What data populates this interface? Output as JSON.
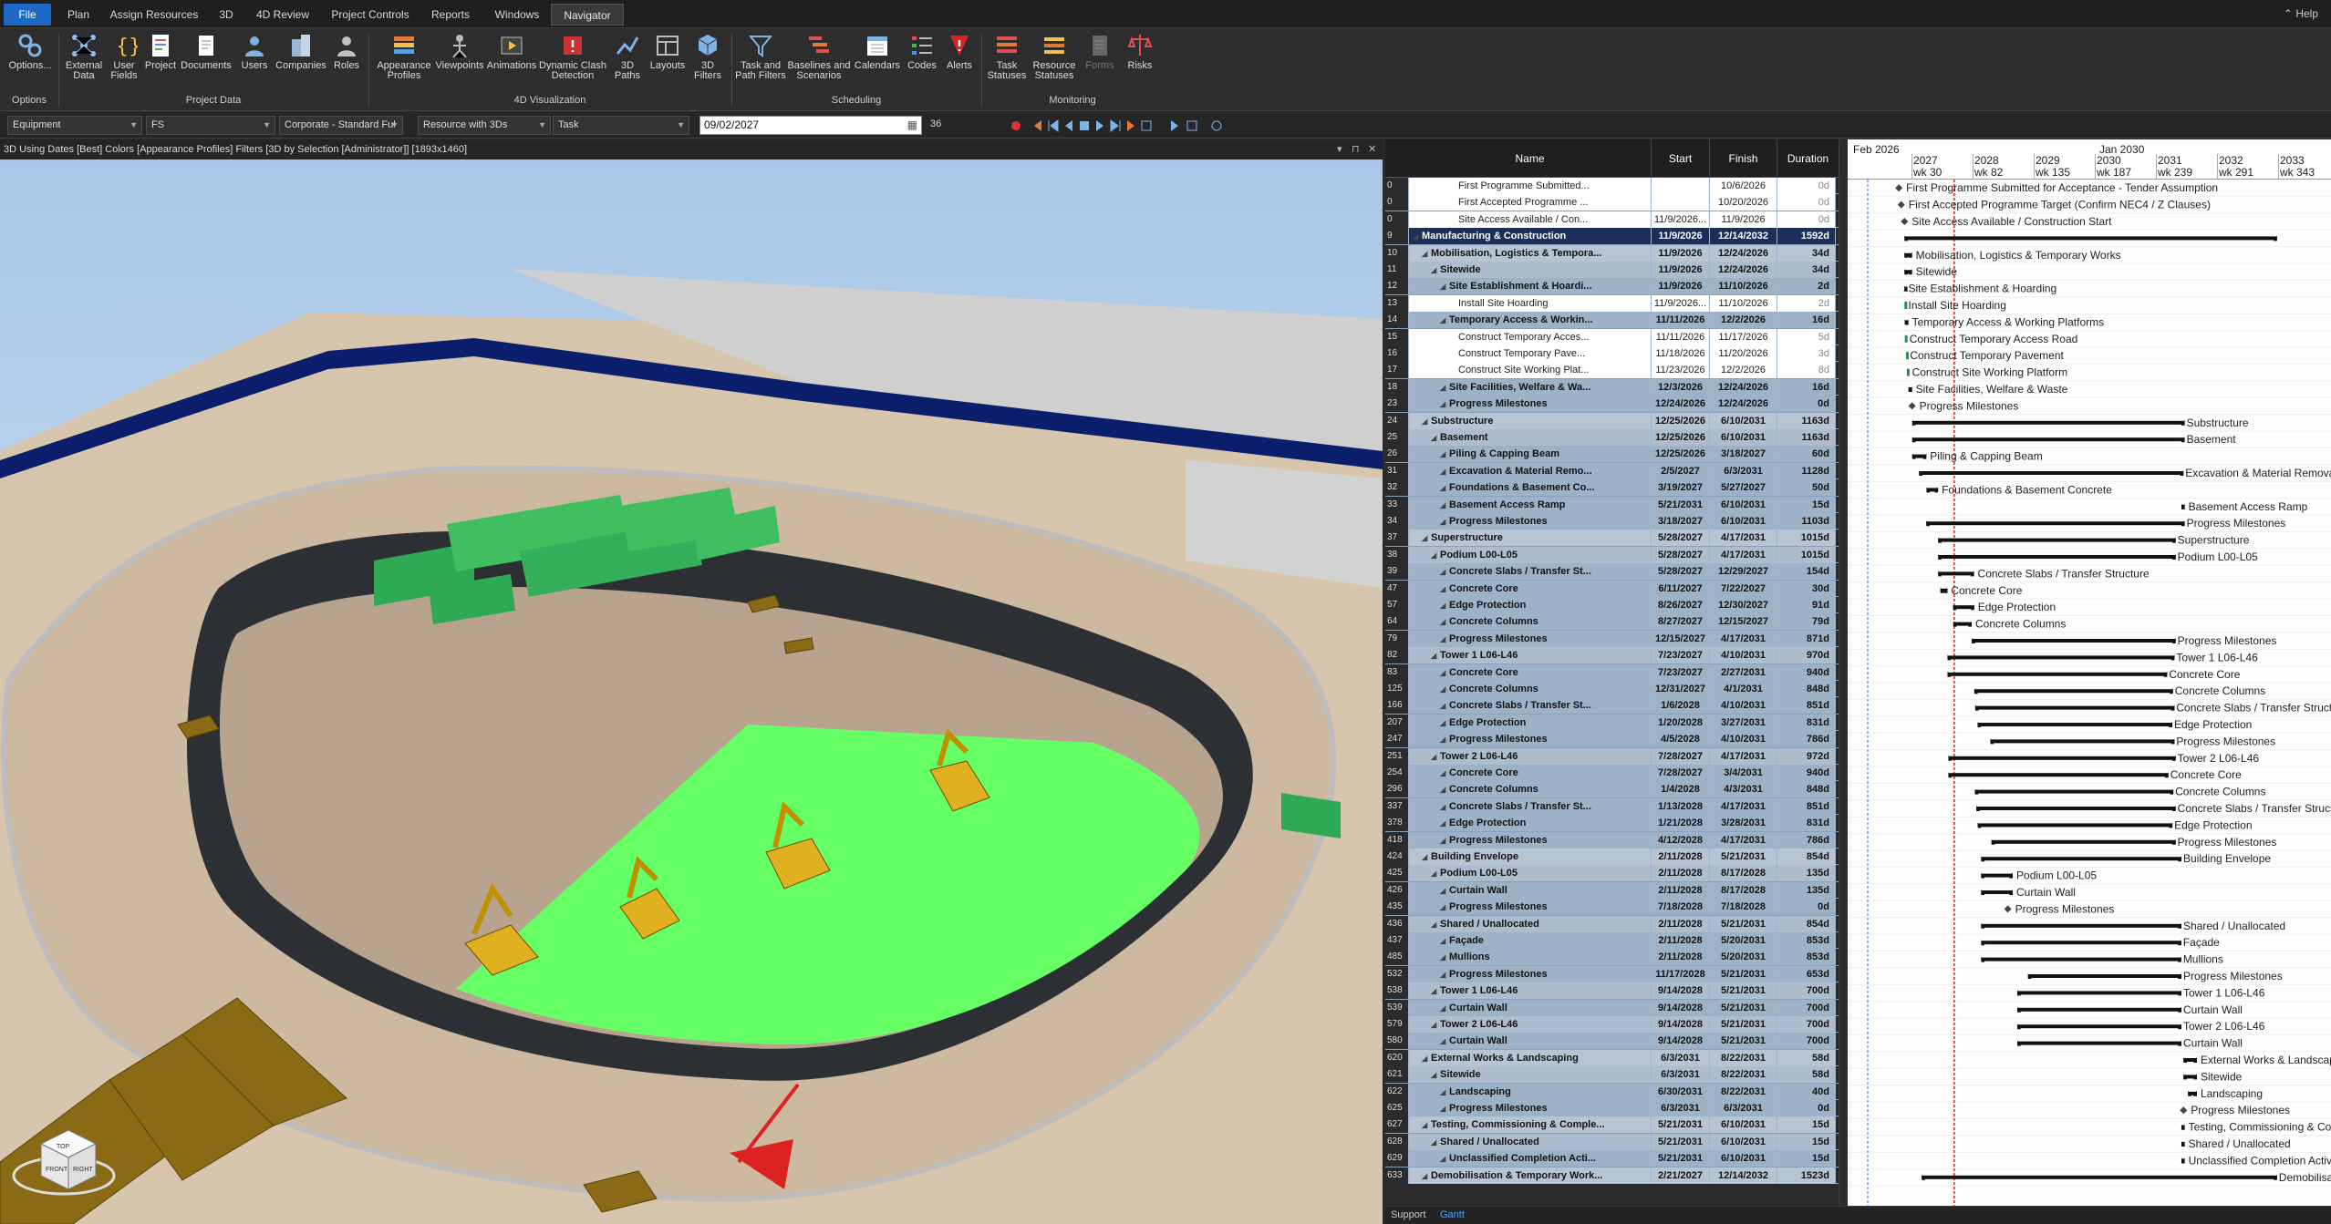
{
  "ribbon_tabs": [
    "File",
    "Plan",
    "Assign Resources",
    "3D",
    "4D Review",
    "Project Controls",
    "Reports",
    "Windows",
    "Navigator"
  ],
  "help_label": "Help",
  "ribbon": {
    "buttons": [
      {
        "label": "Options...",
        "icon": "options-icon"
      },
      {
        "label": "External\nData",
        "icon": "external-data-icon"
      },
      {
        "label": "User\nFields",
        "icon": "user-fields-icon"
      },
      {
        "label": "Project",
        "icon": "project-icon"
      },
      {
        "label": "Documents",
        "icon": "documents-icon"
      },
      {
        "label": "Users",
        "icon": "users-icon"
      },
      {
        "label": "Companies",
        "icon": "companies-icon"
      },
      {
        "label": "Roles",
        "icon": "roles-icon"
      },
      {
        "label": "Appearance\nProfiles",
        "icon": "appearance-profiles-icon"
      },
      {
        "label": "Viewpoints",
        "icon": "viewpoints-icon"
      },
      {
        "label": "Animations",
        "icon": "animations-icon"
      },
      {
        "label": "Dynamic Clash\nDetection",
        "icon": "clash-detection-icon"
      },
      {
        "label": "3D\nPaths",
        "icon": "3d-paths-icon"
      },
      {
        "label": "Layouts",
        "icon": "layouts-icon"
      },
      {
        "label": "3D\nFilters",
        "icon": "3d-filters-icon"
      },
      {
        "label": "Task and\nPath Filters",
        "icon": "task-filters-icon"
      },
      {
        "label": "Baselines and\nScenarios",
        "icon": "baselines-icon"
      },
      {
        "label": "Calendars",
        "icon": "calendars-icon"
      },
      {
        "label": "Codes",
        "icon": "codes-icon"
      },
      {
        "label": "Alerts",
        "icon": "alerts-icon"
      },
      {
        "label": "Task\nStatuses",
        "icon": "task-statuses-icon"
      },
      {
        "label": "Resource\nStatuses",
        "icon": "resource-statuses-icon"
      },
      {
        "label": "Forms",
        "icon": "forms-icon"
      },
      {
        "label": "Risks",
        "icon": "risks-icon"
      }
    ],
    "groups": [
      "Options",
      "Project Data",
      "4D Visualization",
      "Scheduling",
      "Monitoring"
    ]
  },
  "toolbar": {
    "combo1": "Equipment",
    "combo2": "FS",
    "combo3": "Corporate - Standard Ful",
    "combo4": "Resource with 3Ds",
    "combo5": "Task",
    "date": "09/02/2027",
    "step": "36"
  },
  "viewport": {
    "title": "3D Using Dates [Best] Colors [Appearance Profiles] Filters [3D by Selection [Administrator]] [1893x1460]",
    "viewcube": {
      "top": "TOP",
      "front": "FRONT",
      "right": "RIGHT"
    }
  },
  "grid": {
    "columns": [
      "Name",
      "Start",
      "Finish",
      "Duration"
    ],
    "rows": [
      {
        "id": "0",
        "level": "leaf",
        "indent": 4,
        "name": "First Programme Submitted...",
        "start": "",
        "finish": "10/6/2026",
        "dur": "0d"
      },
      {
        "id": "0",
        "level": "leaf",
        "indent": 4,
        "name": "First Accepted Programme ...",
        "start": "",
        "finish": "10/20/2026",
        "dur": "0d"
      },
      {
        "id": "0",
        "level": "leaf",
        "indent": 4,
        "name": "Site Access Available / Con...",
        "start": "11/9/2026...",
        "finish": "11/9/2026",
        "dur": "0d"
      },
      {
        "id": "9",
        "level": "top",
        "indent": 0,
        "name": "Manufacturing & Construction",
        "start": "11/9/2026",
        "finish": "12/14/2032",
        "dur": "1592d"
      },
      {
        "id": "10",
        "level": "1",
        "indent": 1,
        "name": "Mobilisation, Logistics & Tempora...",
        "start": "11/9/2026",
        "finish": "12/24/2026",
        "dur": "34d"
      },
      {
        "id": "11",
        "level": "2",
        "indent": 2,
        "name": "Sitewide",
        "start": "11/9/2026",
        "finish": "12/24/2026",
        "dur": "34d"
      },
      {
        "id": "12",
        "level": "3",
        "indent": 3,
        "name": "Site Establishment & Hoardi...",
        "start": "11/9/2026",
        "finish": "11/10/2026",
        "dur": "2d"
      },
      {
        "id": "13",
        "level": "leaf",
        "indent": 4,
        "name": "Install Site Hoarding",
        "start": "11/9/2026...",
        "finish": "11/10/2026",
        "dur": "2d"
      },
      {
        "id": "14",
        "level": "3",
        "indent": 3,
        "name": "Temporary Access & Workin...",
        "start": "11/11/2026",
        "finish": "12/2/2026",
        "dur": "16d"
      },
      {
        "id": "15",
        "level": "leaf",
        "indent": 4,
        "name": "Construct Temporary Acces...",
        "start": "11/11/2026",
        "finish": "11/17/2026",
        "dur": "5d"
      },
      {
        "id": "16",
        "level": "leaf",
        "indent": 4,
        "name": "Construct Temporary Pave...",
        "start": "11/18/2026",
        "finish": "11/20/2026",
        "dur": "3d"
      },
      {
        "id": "17",
        "level": "leaf",
        "indent": 4,
        "name": "Construct Site Working Plat...",
        "start": "11/23/2026",
        "finish": "12/2/2026",
        "dur": "8d"
      },
      {
        "id": "18",
        "level": "3",
        "indent": 3,
        "name": "Site Facilities, Welfare & Wa...",
        "start": "12/3/2026",
        "finish": "12/24/2026",
        "dur": "16d"
      },
      {
        "id": "23",
        "level": "3",
        "indent": 3,
        "name": "Progress Milestones",
        "start": "12/24/2026",
        "finish": "12/24/2026",
        "dur": "0d"
      },
      {
        "id": "24",
        "level": "1",
        "indent": 1,
        "name": "Substructure",
        "start": "12/25/2026",
        "finish": "6/10/2031",
        "dur": "1163d"
      },
      {
        "id": "25",
        "level": "2",
        "indent": 2,
        "name": "Basement",
        "start": "12/25/2026",
        "finish": "6/10/2031",
        "dur": "1163d"
      },
      {
        "id": "26",
        "level": "3",
        "indent": 3,
        "name": "Piling & Capping Beam",
        "start": "12/25/2026",
        "finish": "3/18/2027",
        "dur": "60d"
      },
      {
        "id": "31",
        "level": "3",
        "indent": 3,
        "name": "Excavation & Material Remo...",
        "start": "2/5/2027",
        "finish": "6/3/2031",
        "dur": "1128d"
      },
      {
        "id": "32",
        "level": "3",
        "indent": 3,
        "name": "Foundations & Basement Co...",
        "start": "3/19/2027",
        "finish": "5/27/2027",
        "dur": "50d"
      },
      {
        "id": "33",
        "level": "3",
        "indent": 3,
        "name": "Basement Access Ramp",
        "start": "5/21/2031",
        "finish": "6/10/2031",
        "dur": "15d"
      },
      {
        "id": "34",
        "level": "3",
        "indent": 3,
        "name": "Progress Milestones",
        "start": "3/18/2027",
        "finish": "6/10/2031",
        "dur": "1103d"
      },
      {
        "id": "37",
        "level": "1",
        "indent": 1,
        "name": "Superstructure",
        "start": "5/28/2027",
        "finish": "4/17/2031",
        "dur": "1015d"
      },
      {
        "id": "38",
        "level": "2",
        "indent": 2,
        "name": "Podium L00-L05",
        "start": "5/28/2027",
        "finish": "4/17/2031",
        "dur": "1015d"
      },
      {
        "id": "39",
        "level": "3",
        "indent": 3,
        "name": "Concrete Slabs / Transfer St...",
        "start": "5/28/2027",
        "finish": "12/29/2027",
        "dur": "154d"
      },
      {
        "id": "47",
        "level": "3",
        "indent": 3,
        "name": "Concrete Core",
        "start": "6/11/2027",
        "finish": "7/22/2027",
        "dur": "30d"
      },
      {
        "id": "57",
        "level": "3",
        "indent": 3,
        "name": "Edge Protection",
        "start": "8/26/2027",
        "finish": "12/30/2027",
        "dur": "91d"
      },
      {
        "id": "64",
        "level": "3",
        "indent": 3,
        "name": "Concrete Columns",
        "start": "8/27/2027",
        "finish": "12/15/2027",
        "dur": "79d"
      },
      {
        "id": "79",
        "level": "3",
        "indent": 3,
        "name": "Progress Milestones",
        "start": "12/15/2027",
        "finish": "4/17/2031",
        "dur": "871d"
      },
      {
        "id": "82",
        "level": "2",
        "indent": 2,
        "name": "Tower 1 L06-L46",
        "start": "7/23/2027",
        "finish": "4/10/2031",
        "dur": "970d"
      },
      {
        "id": "83",
        "level": "3",
        "indent": 3,
        "name": "Concrete Core",
        "start": "7/23/2027",
        "finish": "2/27/2031",
        "dur": "940d"
      },
      {
        "id": "125",
        "level": "3",
        "indent": 3,
        "name": "Concrete Columns",
        "start": "12/31/2027",
        "finish": "4/1/2031",
        "dur": "848d"
      },
      {
        "id": "166",
        "level": "3",
        "indent": 3,
        "name": "Concrete Slabs / Transfer St...",
        "start": "1/6/2028",
        "finish": "4/10/2031",
        "dur": "851d"
      },
      {
        "id": "207",
        "level": "3",
        "indent": 3,
        "name": "Edge Protection",
        "start": "1/20/2028",
        "finish": "3/27/2031",
        "dur": "831d"
      },
      {
        "id": "247",
        "level": "3",
        "indent": 3,
        "name": "Progress Milestones",
        "start": "4/5/2028",
        "finish": "4/10/2031",
        "dur": "786d"
      },
      {
        "id": "251",
        "level": "2",
        "indent": 2,
        "name": "Tower 2 L06-L46",
        "start": "7/28/2027",
        "finish": "4/17/2031",
        "dur": "972d"
      },
      {
        "id": "254",
        "level": "3",
        "indent": 3,
        "name": "Concrete Core",
        "start": "7/28/2027",
        "finish": "3/4/2031",
        "dur": "940d"
      },
      {
        "id": "296",
        "level": "3",
        "indent": 3,
        "name": "Concrete Columns",
        "start": "1/4/2028",
        "finish": "4/3/2031",
        "dur": "848d"
      },
      {
        "id": "337",
        "level": "3",
        "indent": 3,
        "name": "Concrete Slabs / Transfer St...",
        "start": "1/13/2028",
        "finish": "4/17/2031",
        "dur": "851d"
      },
      {
        "id": "378",
        "level": "3",
        "indent": 3,
        "name": "Edge Protection",
        "start": "1/21/2028",
        "finish": "3/28/2031",
        "dur": "831d"
      },
      {
        "id": "418",
        "level": "3",
        "indent": 3,
        "name": "Progress Milestones",
        "start": "4/12/2028",
        "finish": "4/17/2031",
        "dur": "786d"
      },
      {
        "id": "424",
        "level": "1",
        "indent": 1,
        "name": "Building Envelope",
        "start": "2/11/2028",
        "finish": "5/21/2031",
        "dur": "854d"
      },
      {
        "id": "425",
        "level": "2",
        "indent": 2,
        "name": "Podium L00-L05",
        "start": "2/11/2028",
        "finish": "8/17/2028",
        "dur": "135d"
      },
      {
        "id": "426",
        "level": "3",
        "indent": 3,
        "name": "Curtain Wall",
        "start": "2/11/2028",
        "finish": "8/17/2028",
        "dur": "135d"
      },
      {
        "id": "435",
        "level": "3",
        "indent": 3,
        "name": "Progress Milestones",
        "start": "7/18/2028",
        "finish": "7/18/2028",
        "dur": "0d"
      },
      {
        "id": "436",
        "level": "2",
        "indent": 2,
        "name": "Shared / Unallocated",
        "start": "2/11/2028",
        "finish": "5/21/2031",
        "dur": "854d"
      },
      {
        "id": "437",
        "level": "3",
        "indent": 3,
        "name": "Façade",
        "start": "2/11/2028",
        "finish": "5/20/2031",
        "dur": "853d"
      },
      {
        "id": "485",
        "level": "3",
        "indent": 3,
        "name": "Mullions",
        "start": "2/11/2028",
        "finish": "5/20/2031",
        "dur": "853d"
      },
      {
        "id": "532",
        "level": "3",
        "indent": 3,
        "name": "Progress Milestones",
        "start": "11/17/2028",
        "finish": "5/21/2031",
        "dur": "653d"
      },
      {
        "id": "538",
        "level": "2",
        "indent": 2,
        "name": "Tower 1 L06-L46",
        "start": "9/14/2028",
        "finish": "5/21/2031",
        "dur": "700d"
      },
      {
        "id": "539",
        "level": "3",
        "indent": 3,
        "name": "Curtain Wall",
        "start": "9/14/2028",
        "finish": "5/21/2031",
        "dur": "700d"
      },
      {
        "id": "579",
        "level": "2",
        "indent": 2,
        "name": "Tower 2 L06-L46",
        "start": "9/14/2028",
        "finish": "5/21/2031",
        "dur": "700d"
      },
      {
        "id": "580",
        "level": "3",
        "indent": 3,
        "name": "Curtain Wall",
        "start": "9/14/2028",
        "finish": "5/21/2031",
        "dur": "700d"
      },
      {
        "id": "620",
        "level": "1",
        "indent": 1,
        "name": "External Works & Landscaping",
        "start": "6/3/2031",
        "finish": "8/22/2031",
        "dur": "58d"
      },
      {
        "id": "621",
        "level": "2",
        "indent": 2,
        "name": "Sitewide",
        "start": "6/3/2031",
        "finish": "8/22/2031",
        "dur": "58d"
      },
      {
        "id": "622",
        "level": "3",
        "indent": 3,
        "name": "Landscaping",
        "start": "6/30/2031",
        "finish": "8/22/2031",
        "dur": "40d"
      },
      {
        "id": "625",
        "level": "3",
        "indent": 3,
        "name": "Progress Milestones",
        "start": "6/3/2031",
        "finish": "6/3/2031",
        "dur": "0d"
      },
      {
        "id": "627",
        "level": "1",
        "indent": 1,
        "name": "Testing, Commissioning & Comple...",
        "start": "5/21/2031",
        "finish": "6/10/2031",
        "dur": "15d"
      },
      {
        "id": "628",
        "level": "2",
        "indent": 2,
        "name": "Shared / Unallocated",
        "start": "5/21/2031",
        "finish": "6/10/2031",
        "dur": "15d"
      },
      {
        "id": "629",
        "level": "3",
        "indent": 3,
        "name": "Unclassified Completion Acti...",
        "start": "5/21/2031",
        "finish": "6/10/2031",
        "dur": "15d"
      },
      {
        "id": "633",
        "level": "1",
        "indent": 1,
        "name": "Demobilisation & Temporary Work...",
        "start": "2/21/2027",
        "finish": "12/14/2032",
        "dur": "1523d"
      }
    ]
  },
  "gantt": {
    "header_month": "Feb 2026",
    "header_month2": "Jan 2030",
    "years": [
      "2027",
      "2028",
      "2029",
      "2030",
      "2031",
      "2032",
      "2033"
    ],
    "weeks": [
      "wk 30",
      "wk 82",
      "wk 135",
      "wk 187",
      "wk 239",
      "wk 291",
      "wk 343"
    ],
    "labels": [
      "First Programme Submitted for Acceptance - Tender Assumption",
      "First Accepted Programme Target (Confirm NEC4 / Z Clauses)",
      "Site Access Available / Construction Start",
      "",
      "Mobilisation, Logistics & Temporary Works",
      "Sitewide",
      "Site Establishment & Hoarding",
      "Install Site Hoarding",
      "Temporary Access & Working Platforms",
      "Construct Temporary Access Road",
      "Construct Temporary Pavement",
      "Construct Site Working Platform",
      "Site Facilities, Welfare & Waste",
      "Progress Milestones",
      "Substructure",
      "Basement",
      "Piling & Capping Beam",
      "Excavation & Material Removal",
      "Foundations & Basement Concrete",
      "Basement Access Ramp",
      "Progress Milestones",
      "Superstructure",
      "Podium L00-L05",
      "Concrete Slabs / Transfer Structure",
      "Concrete Core",
      "Edge Protection",
      "Concrete Columns",
      "Progress Milestones",
      "Tower 1 L06-L46",
      "Concrete Core",
      "Concrete Columns",
      "Concrete Slabs / Transfer Structure",
      "Edge Protection",
      "Progress Milestones",
      "Tower 2 L06-L46",
      "Concrete Core",
      "Concrete Columns",
      "Concrete Slabs / Transfer Structure",
      "Edge Protection",
      "Progress Milestones",
      "Building Envelope",
      "Podium L00-L05",
      "Curtain Wall",
      "Progress Milestones",
      "Shared / Unallocated",
      "Façade",
      "Mullions",
      "Progress Milestones",
      "Tower 1 L06-L46",
      "Curtain Wall",
      "Tower 2 L06-L46",
      "Curtain Wall",
      "External Works & Landscaping",
      "Sitewide",
      "Landscaping",
      "Progress Milestones",
      "Testing, Commissioning & Completion",
      "Shared / Unallocated",
      "Unclassified Completion Activities",
      "Demobilisation & Temporary Works"
    ],
    "status_date": "09/02/2027"
  },
  "bottom_tabs": [
    "Support",
    "Gantt"
  ],
  "colors": {
    "ribbon_bg": "#2d2d2d",
    "accent": "#1d68c4",
    "active_green": "#66ff66",
    "summary_row": "#1c2f59"
  }
}
